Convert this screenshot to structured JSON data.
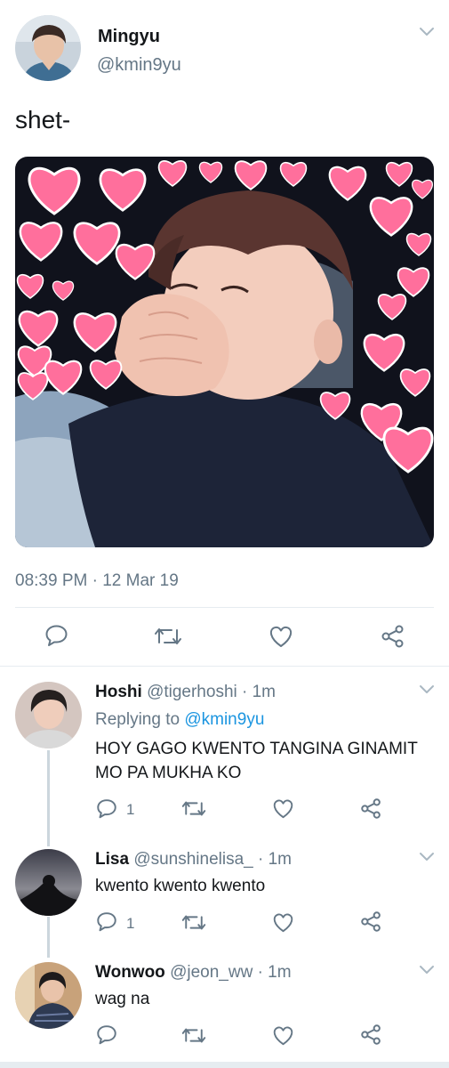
{
  "tweet": {
    "author_name": "Mingyu",
    "author_handle": "@kmin9yu",
    "text": "shet-",
    "timestamp": "08:39 PM · 12 Mar 19"
  },
  "replies": [
    {
      "name": "Hoshi",
      "handle_time": "@tigerhoshi · 1m",
      "replying_prefix": "Replying to",
      "replying_handle": "@kmin9yu",
      "text": "HOY GAGO KWENTO TANGINA GINAMIT MO PA MUKHA KO",
      "reply_count": "1"
    },
    {
      "name": "Lisa",
      "handle_time": "@sunshinelisa_ · 1m",
      "text": "kwento kwento kwento",
      "reply_count": "1"
    },
    {
      "name": "Wonwoo",
      "handle_time": "@jeon_ww · 1m",
      "text": "wag na",
      "reply_count": ""
    }
  ],
  "colors": {
    "accent": "#1b95e0",
    "muted": "#657786",
    "divider": "#e6ecf0",
    "thread_line": "#ccd6dd",
    "heart_pink": "#ff6f9c",
    "photo_bg": "#10121c"
  },
  "icons": [
    "chevron-down-icon",
    "reply-icon",
    "retweet-icon",
    "like-icon",
    "share-icon"
  ]
}
